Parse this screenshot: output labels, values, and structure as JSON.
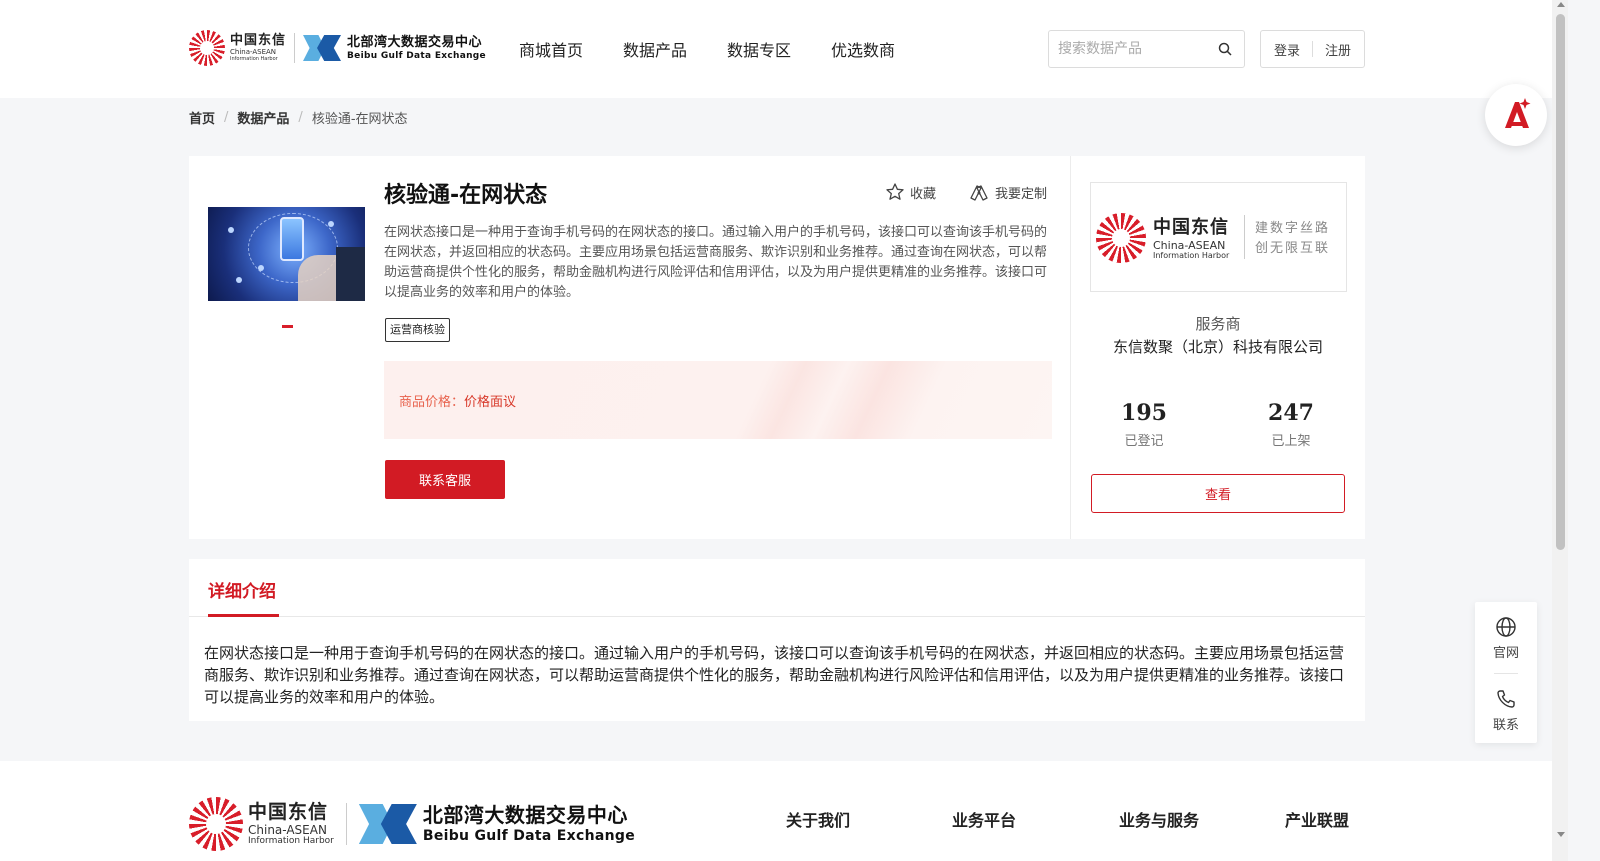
{
  "header": {
    "logo_cdx": {
      "cn": "中国东信",
      "en1": "China-ASEAN",
      "en2": "Information Harbor"
    },
    "logo_bgx": {
      "cn": "北部湾大数据交易中心",
      "en": "Beibu Gulf Data Exchange"
    },
    "nav": [
      "商城首页",
      "数据产品",
      "数据专区",
      "优选数商"
    ],
    "search": {
      "placeholder": "搜索数据产品",
      "value": ""
    },
    "login": "登录",
    "register": "注册"
  },
  "breadcrumb": {
    "home": "首页",
    "category": "数据产品",
    "current": "核验通-在网状态"
  },
  "product": {
    "title": "核验通-在网状态",
    "favorite": "收藏",
    "customize": "我要定制",
    "description": "在网状态接口是一种用于查询手机号码的在网状态的接口。通过输入用户的手机号码，该接口可以查询该手机号码的在网状态，并返回相应的状态码。主要应用场景包括运营商服务、欺诈识别和业务推荐。通过查询在网状态，可以帮助运营商提供个性化的服务，帮助金融机构进行风险评估和信用评估，以及为用户提供更精准的业务推荐。该接口可以提高业务的效率和用户的体验。",
    "tag": "运营商核验",
    "price_label": "商品价格：",
    "price_value": "价格面议",
    "contact_button": "联系客服"
  },
  "provider": {
    "logo": {
      "cn": "中国东信",
      "en1": "China-ASEAN",
      "en2": "Information Harbor",
      "slogan1": "建数字丝路",
      "slogan2": "创无限互联"
    },
    "role": "服务商",
    "name": "东信数聚（北京）科技有限公司",
    "stats": [
      {
        "value": "195",
        "label": "已登记"
      },
      {
        "value": "247",
        "label": "已上架"
      }
    ],
    "view_button": "查看"
  },
  "detail": {
    "tab": "详细介绍",
    "text": "在网状态接口是一种用于查询手机号码的在网状态的接口。通过输入用户的手机号码，该接口可以查询该手机号码的在网状态，并返回相应的状态码。主要应用场景包括运营商服务、欺诈识别和业务推荐。通过查询在网状态，可以帮助运营商提供个性化的服务，帮助金融机构进行风险评估和信用评估，以及为用户提供更精准的业务推荐。该接口可以提高业务的效率和用户的体验。"
  },
  "side_float": {
    "website": "官网",
    "contact": "联系"
  },
  "footer": {
    "logo_cdx": {
      "cn": "中国东信",
      "en1": "China-ASEAN",
      "en2": "Information Harbor"
    },
    "logo_bgx": {
      "cn": "北部湾大数据交易中心",
      "en": "Beibu Gulf Data Exchange"
    },
    "nav": [
      "关于我们",
      "业务平台",
      "业务与服务",
      "产业联盟"
    ]
  },
  "colors": {
    "brand_red": "#d21b24",
    "price_red": "#d8392a",
    "logo_blue": "#1b5aa6"
  },
  "icons": [
    "search-icon",
    "star-icon",
    "customize-icon",
    "globe-icon",
    "phone-icon",
    "ai-assistant-icon"
  ]
}
